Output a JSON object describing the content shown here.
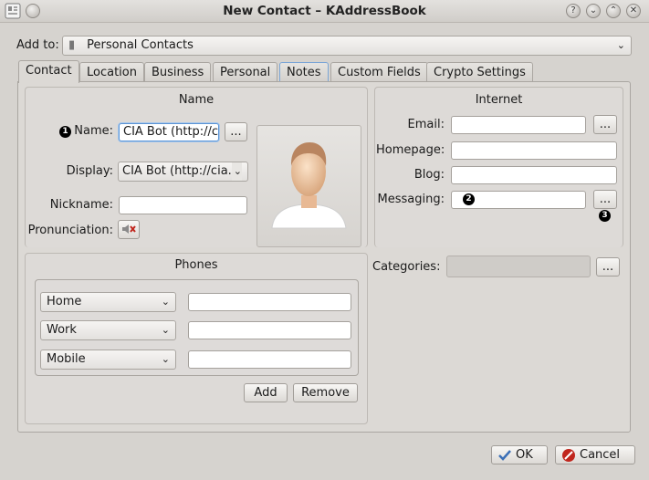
{
  "window": {
    "title": "New Contact – KAddressBook"
  },
  "add_to": {
    "label": "Add to:",
    "value": "Personal Contacts"
  },
  "tabs": [
    {
      "label": "Contact"
    },
    {
      "label": "Location"
    },
    {
      "label": "Business"
    },
    {
      "label": "Personal"
    },
    {
      "label": "Notes"
    },
    {
      "label": "Custom Fields"
    },
    {
      "label": "Crypto Settings"
    }
  ],
  "name_group": {
    "title": "Name",
    "name_label": "Name:",
    "name_value": "CIA Bot (http://cia.",
    "more_label": "...",
    "display_label": "Display:",
    "display_value": "CIA Bot (http://cia.v",
    "nickname_label": "Nickname:",
    "nickname_value": "",
    "pronunciation_label": "Pronunciation:"
  },
  "internet_group": {
    "title": "Internet",
    "email_label": "Email:",
    "email_value": "",
    "homepage_label": "Homepage:",
    "homepage_value": "",
    "blog_label": "Blog:",
    "blog_value": "",
    "messaging_label": "Messaging:",
    "messaging_value": "",
    "more_label": "..."
  },
  "categories": {
    "label": "Categories:",
    "value": "",
    "more_label": "..."
  },
  "phones_group": {
    "title": "Phones",
    "rows": [
      {
        "type": "Home",
        "value": ""
      },
      {
        "type": "Work",
        "value": ""
      },
      {
        "type": "Mobile",
        "value": ""
      }
    ],
    "add_label": "Add",
    "remove_label": "Remove"
  },
  "markers": [
    "1",
    "2",
    "3"
  ],
  "buttons": {
    "ok": "OK",
    "cancel": "Cancel"
  },
  "colors": {
    "focus": "#5a94d6",
    "cancel_red": "#c0261d",
    "ok_blue": "#3b6fb6"
  }
}
